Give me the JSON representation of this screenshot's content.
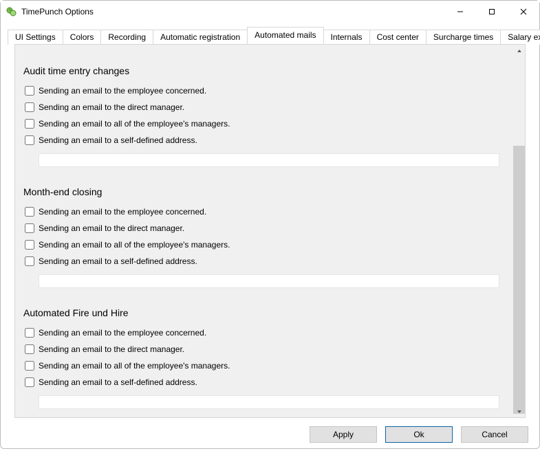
{
  "window": {
    "title": "TimePunch Options"
  },
  "tabs": [
    {
      "label": "UI Settings",
      "active": false
    },
    {
      "label": "Colors",
      "active": false
    },
    {
      "label": "Recording",
      "active": false
    },
    {
      "label": "Automatic registration",
      "active": false
    },
    {
      "label": "Automated mails",
      "active": true
    },
    {
      "label": "Internals",
      "active": false
    },
    {
      "label": "Cost center",
      "active": false
    },
    {
      "label": "Surcharge times",
      "active": false
    },
    {
      "label": "Salary export",
      "active": false
    }
  ],
  "sections": [
    {
      "title": "Audit time entry changes",
      "options": [
        {
          "label": "Sending an email to the employee concerned.",
          "checked": false
        },
        {
          "label": "Sending an email to the direct manager.",
          "checked": false
        },
        {
          "label": "Sending an email to all of the employee's managers.",
          "checked": false
        },
        {
          "label": "Sending an email to a self-defined address.",
          "checked": false
        }
      ],
      "address": ""
    },
    {
      "title": "Month-end closing",
      "options": [
        {
          "label": "Sending an email to the employee concerned.",
          "checked": false
        },
        {
          "label": "Sending an email to the direct manager.",
          "checked": false
        },
        {
          "label": "Sending an email to all of the employee's managers.",
          "checked": false
        },
        {
          "label": "Sending an email to a self-defined address.",
          "checked": false
        }
      ],
      "address": ""
    },
    {
      "title": "Automated Fire und Hire",
      "options": [
        {
          "label": "Sending an email to the employee concerned.",
          "checked": false
        },
        {
          "label": "Sending an email to the direct manager.",
          "checked": false
        },
        {
          "label": "Sending an email to all of the employee's managers.",
          "checked": false
        },
        {
          "label": "Sending an email to a self-defined address.",
          "checked": false
        }
      ],
      "address": ""
    }
  ],
  "footer": {
    "apply": "Apply",
    "ok": "Ok",
    "cancel": "Cancel"
  }
}
